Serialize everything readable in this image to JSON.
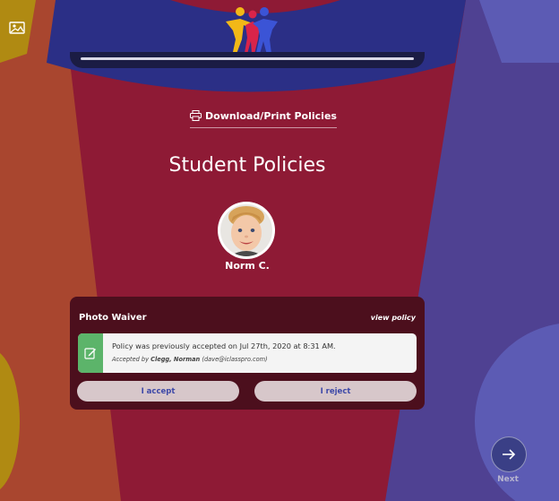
{
  "theme": {
    "background": "#8e1a35",
    "left_band": "#a9462f",
    "right_band": "#4f4192",
    "top_banner": "#2b2f86",
    "accent_green": "#5cb46a",
    "button_text": "#3e49a8"
  },
  "header": {
    "corner_icon": "image-gallery-icon",
    "logo_icon": "kids-logo-icon"
  },
  "download": {
    "icon": "printer-icon",
    "label": "Download/Print Policies"
  },
  "page": {
    "title": "Student Policies"
  },
  "student": {
    "name": "Norm C."
  },
  "policy": {
    "title": "Photo Waiver",
    "view_label": "view policy",
    "notice_icon": "signed-document-icon",
    "notice_prefix": "Policy was previously accepted on ",
    "notice_date": "Jul 27th, 2020 at 8:31 AM",
    "notice_suffix": ".",
    "accepted_prefix": "Accepted by ",
    "accepted_by": "Clegg, Norman",
    "accepted_email": "(dave@iclasspro.com)",
    "accept_label": "I accept",
    "reject_label": "I reject"
  },
  "footer": {
    "next_icon": "arrow-right-icon",
    "next_label": "Next"
  }
}
